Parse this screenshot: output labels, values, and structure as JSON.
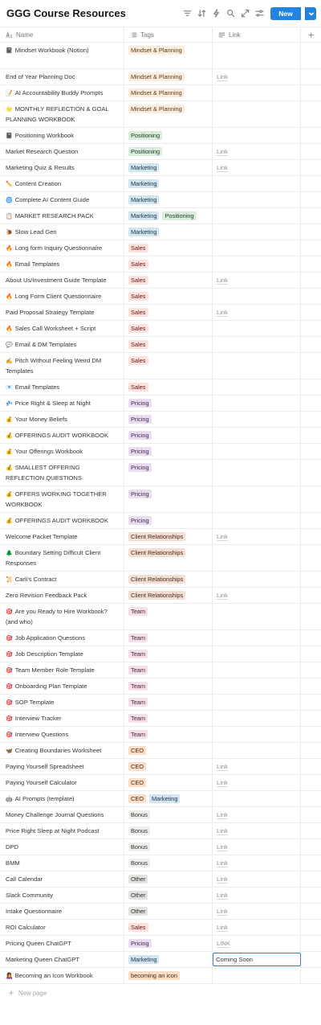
{
  "title": "GGG Course Resources",
  "toolbar": {
    "icons": [
      "filter-icon",
      "sort-icon",
      "automation-bolt-icon",
      "search-icon",
      "expand-icon",
      "settings-sliders-icon"
    ],
    "new_label": "New"
  },
  "columns": {
    "name": "Name",
    "tags": "Tags",
    "link": "Link"
  },
  "tag_colors": {
    "Mindset & Planning": [
      "#fbecdd",
      "#5c3b14"
    ],
    "Positioning": [
      "#dbeddb",
      "#1c3829"
    ],
    "Marketing": [
      "#d3e5ef",
      "#183347"
    ],
    "Sales": [
      "#ffe2dd",
      "#5d1715"
    ],
    "Pricing": [
      "#e8deee",
      "#412454"
    ],
    "Client Relationships": [
      "#f4dfd4",
      "#4a2a1a"
    ],
    "Team": [
      "#f5e0e9",
      "#4c2337"
    ],
    "CEO": [
      "#fadec9",
      "#49290e"
    ],
    "Bonus": [
      "#eeeeed",
      "#32302c"
    ],
    "Other": [
      "#e3e2e0",
      "#32302c"
    ],
    "becoming an icon": [
      "#fadec9",
      "#49290e"
    ]
  },
  "rows": [
    {
      "icon": "📓",
      "name": "Mindset Workbook (Notion)",
      "tags": [
        "Mindset & Planning"
      ],
      "link": "",
      "h": 33
    },
    {
      "icon": "",
      "name": "End of Year Planning Doc",
      "tags": [
        "Mindset & Planning"
      ],
      "link": "Link",
      "h": 20
    },
    {
      "icon": "📝",
      "name": "AI Accountability Buddy Prompts",
      "tags": [
        "Mindset & Planning"
      ],
      "link": "",
      "h": 20
    },
    {
      "icon": "🌟",
      "name": "MONTHLY REFLECTION & GOAL PLANNING WORKBOOK",
      "tags": [
        "Mindset & Planning"
      ],
      "link": "",
      "h": 33
    },
    {
      "icon": "📓",
      "name": "Positioning Workbook",
      "tags": [
        "Positioning"
      ],
      "link": "",
      "h": 20
    },
    {
      "icon": "",
      "name": "Market Research Question",
      "tags": [
        "Positioning"
      ],
      "link": "Link",
      "h": 20
    },
    {
      "icon": "",
      "name": "Marketing Quiz & Results",
      "tags": [
        "Marketing"
      ],
      "link": "Link",
      "h": 20
    },
    {
      "icon": "✏️",
      "name": "Content Creation",
      "tags": [
        "Marketing"
      ],
      "link": "",
      "h": 20
    },
    {
      "icon": "🌀",
      "name": "Complete AI Content Guide",
      "tags": [
        "Marketing"
      ],
      "link": "",
      "h": 20
    },
    {
      "icon": "📋",
      "name": "MARKET RESEARCH PACK",
      "tags": [
        "Marketing",
        "Positioning"
      ],
      "link": "",
      "h": 20
    },
    {
      "icon": "🐌",
      "name": "Slow Lead Gen",
      "tags": [
        "Marketing"
      ],
      "link": "",
      "h": 20
    },
    {
      "icon": "🔥",
      "name": "Long form Inquiry Questionnaire",
      "tags": [
        "Sales"
      ],
      "link": "",
      "h": 20
    },
    {
      "icon": "🔥",
      "name": "Email Templates",
      "tags": [
        "Sales"
      ],
      "link": "",
      "h": 20
    },
    {
      "icon": "",
      "name": "About Us/Investment Guide Template",
      "tags": [
        "Sales"
      ],
      "link": "Link",
      "h": 20
    },
    {
      "icon": "🔥",
      "name": "Long Form Client Questionnaire",
      "tags": [
        "Sales"
      ],
      "link": "",
      "h": 20
    },
    {
      "icon": "",
      "name": "Paid Proposal Strategy Template",
      "tags": [
        "Sales"
      ],
      "link": "Link",
      "h": 20
    },
    {
      "icon": "🔥",
      "name": "Sales Call Worksheet + Script",
      "tags": [
        "Sales"
      ],
      "link": "",
      "h": 20
    },
    {
      "icon": "💬",
      "name": "Email & DM Templates",
      "tags": [
        "Sales"
      ],
      "link": "",
      "h": 20
    },
    {
      "icon": "✍️",
      "name": "Pitch Without Feeling Weird DM Templates",
      "tags": [
        "Sales"
      ],
      "link": "",
      "h": 33
    },
    {
      "icon": "📧",
      "name": "Email Templates",
      "tags": [
        "Sales"
      ],
      "link": "",
      "h": 20
    },
    {
      "icon": "💤",
      "name": "Price Right & Sleep at Night",
      "tags": [
        "Pricing"
      ],
      "link": "",
      "h": 20
    },
    {
      "icon": "💰",
      "name": "Your Money Beliefs",
      "tags": [
        "Pricing"
      ],
      "link": "",
      "h": 20
    },
    {
      "icon": "💰",
      "name": "OFFERINGS AUDIT WORKBOOK",
      "tags": [
        "Pricing"
      ],
      "link": "",
      "h": 20
    },
    {
      "icon": "💰",
      "name": "Your Offerings Workbook",
      "tags": [
        "Pricing"
      ],
      "link": "",
      "h": 20
    },
    {
      "icon": "💰",
      "name": "SMALLEST OFFERING REFLECTION QUESTIONS",
      "tags": [
        "Pricing"
      ],
      "link": "",
      "h": 33
    },
    {
      "icon": "💰",
      "name": "OFFERS WORKING TOGETHER WORKBOOK",
      "tags": [
        "Pricing"
      ],
      "link": "",
      "h": 33
    },
    {
      "icon": "💰",
      "name": "OFFERINGS AUDIT WORKBOOK",
      "tags": [
        "Pricing"
      ],
      "link": "",
      "h": 20
    },
    {
      "icon": "",
      "name": "Welcome Packet Template",
      "tags": [
        "Client Relationships"
      ],
      "link": "Link",
      "h": 20
    },
    {
      "icon": "🌲",
      "name": "Boundary Setting Difficult Client Responses",
      "tags": [
        "Client Relationships"
      ],
      "link": "",
      "h": 33
    },
    {
      "icon": "📜",
      "name": "Carli's Contract",
      "tags": [
        "Client Relationships"
      ],
      "link": "",
      "h": 20
    },
    {
      "icon": "",
      "name": "Zero Revision Feedback Pack",
      "tags": [
        "Client Relationships"
      ],
      "link": "Link",
      "h": 20
    },
    {
      "icon": "🎯",
      "name": "Are you Ready to Hire Workbook? (and who)",
      "tags": [
        "Team"
      ],
      "link": "",
      "h": 33
    },
    {
      "icon": "🎯",
      "name": "Job Application Questions",
      "tags": [
        "Team"
      ],
      "link": "",
      "h": 20
    },
    {
      "icon": "🎯",
      "name": "Job Description Template",
      "tags": [
        "Team"
      ],
      "link": "",
      "h": 20
    },
    {
      "icon": "🎯",
      "name": "Team Member Role Template",
      "tags": [
        "Team"
      ],
      "link": "",
      "h": 20
    },
    {
      "icon": "🎯",
      "name": "Onboarding Plan Template",
      "tags": [
        "Team"
      ],
      "link": "",
      "h": 20
    },
    {
      "icon": "🎯",
      "name": "SOP Template",
      "tags": [
        "Team"
      ],
      "link": "",
      "h": 20
    },
    {
      "icon": "🎯",
      "name": "Interview Tracker",
      "tags": [
        "Team"
      ],
      "link": "",
      "h": 20
    },
    {
      "icon": "🎯",
      "name": "Interview Questions",
      "tags": [
        "Team"
      ],
      "link": "",
      "h": 20
    },
    {
      "icon": "🦋",
      "name": "Creating Boundaries Worksheet",
      "tags": [
        "CEO"
      ],
      "link": "",
      "h": 20
    },
    {
      "icon": "",
      "name": "Paying Yourself Spreadsheet",
      "tags": [
        "CEO"
      ],
      "link": "Link",
      "h": 20
    },
    {
      "icon": "",
      "name": "Paying Yourself Calculator",
      "tags": [
        "CEO"
      ],
      "link": "Link",
      "h": 20
    },
    {
      "icon": "🤖",
      "name": "AI Prompts (template)",
      "tags": [
        "CEO",
        "Marketing"
      ],
      "link": "",
      "h": 20
    },
    {
      "icon": "",
      "name": "Money Challenge Journal Questions",
      "tags": [
        "Bonus"
      ],
      "link": "Link",
      "h": 20
    },
    {
      "icon": "",
      "name": "Price Right Sleep at Night Podcast",
      "tags": [
        "Bonus"
      ],
      "link": "Link",
      "h": 20
    },
    {
      "icon": "",
      "name": "DPD",
      "tags": [
        "Bonus"
      ],
      "link": "Link",
      "h": 20
    },
    {
      "icon": "",
      "name": "BMM",
      "tags": [
        "Bonus"
      ],
      "link": "Link",
      "h": 20
    },
    {
      "icon": "",
      "name": "Call Calendar",
      "tags": [
        "Other"
      ],
      "link": "Link",
      "h": 20
    },
    {
      "icon": "",
      "name": "Slack Community",
      "tags": [
        "Other"
      ],
      "link": "Link",
      "h": 20
    },
    {
      "icon": "",
      "name": "Intake Questionnaire",
      "tags": [
        "Other"
      ],
      "link": "Link",
      "h": 20
    },
    {
      "icon": "",
      "name": "ROI Calculator",
      "tags": [
        "Sales"
      ],
      "link": "Link",
      "h": 20
    },
    {
      "icon": "",
      "name": "Pricing Queen ChatGPT",
      "tags": [
        "Pricing"
      ],
      "link": "LINK",
      "h": 20
    },
    {
      "icon": "",
      "name": "Marketing Queen ChatGPT",
      "tags": [
        "Marketing"
      ],
      "link": "Coming Soon",
      "editing": true,
      "h": 20
    },
    {
      "icon": "👩‍🎤",
      "name": "Becoming an Icon Workbook",
      "tags": [
        "becoming an icon"
      ],
      "link": "",
      "h": 20
    }
  ],
  "new_page_label": "New page"
}
